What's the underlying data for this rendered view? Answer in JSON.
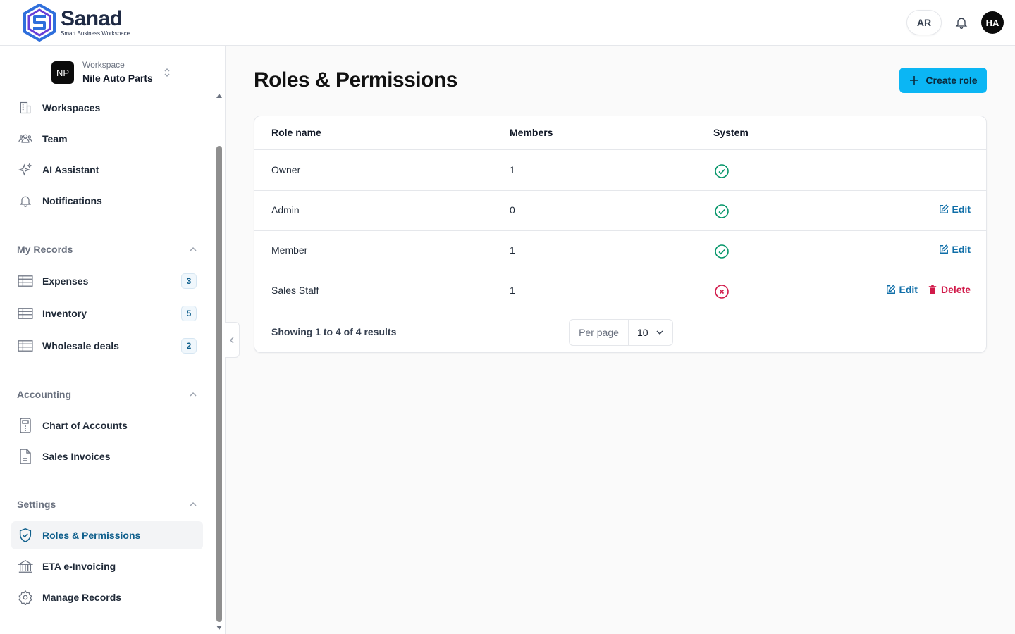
{
  "brand": {
    "name": "Sanad",
    "tagline": "Smart Business Workspace"
  },
  "header": {
    "lang": "AR",
    "user_initials": "HA"
  },
  "workspace": {
    "label": "Workspace",
    "initials": "NP",
    "name": "Nile Auto Parts"
  },
  "sidebar": {
    "top_items": [
      {
        "label": "Workspaces",
        "icon": "building-icon"
      },
      {
        "label": "Team",
        "icon": "users-icon"
      },
      {
        "label": "AI Assistant",
        "icon": "sparkles-icon"
      },
      {
        "label": "Notifications",
        "icon": "bell-icon"
      }
    ],
    "sections": [
      {
        "title": "My Records",
        "items": [
          {
            "label": "Expenses",
            "badge": "3",
            "icon": "table-icon"
          },
          {
            "label": "Inventory",
            "badge": "5",
            "icon": "table-icon"
          },
          {
            "label": "Wholesale deals",
            "badge": "2",
            "icon": "table-icon"
          }
        ]
      },
      {
        "title": "Accounting",
        "items": [
          {
            "label": "Chart of Accounts",
            "icon": "calculator-icon"
          },
          {
            "label": "Sales Invoices",
            "icon": "document-icon"
          }
        ]
      },
      {
        "title": "Settings",
        "items": [
          {
            "label": "Roles & Permissions",
            "icon": "shield-check-icon",
            "active": true
          },
          {
            "label": "ETA e-Invoicing",
            "icon": "bank-icon"
          },
          {
            "label": "Manage Records",
            "icon": "gear-icon"
          }
        ]
      }
    ]
  },
  "main": {
    "title": "Roles & Permissions",
    "create_label": "Create role",
    "table": {
      "headers": {
        "role": "Role name",
        "members": "Members",
        "system": "System"
      },
      "rows": [
        {
          "role": "Owner",
          "members": "1",
          "system": true,
          "edit": false,
          "delete": false
        },
        {
          "role": "Admin",
          "members": "0",
          "system": true,
          "edit": true,
          "delete": false
        },
        {
          "role": "Member",
          "members": "1",
          "system": true,
          "edit": true,
          "delete": false
        },
        {
          "role": "Sales Staff",
          "members": "1",
          "system": false,
          "edit": true,
          "delete": true
        }
      ],
      "edit_label": "Edit",
      "delete_label": "Delete"
    },
    "pagination": {
      "showing": "Showing 1 to 4 of 4 results",
      "per_page_label": "Per page",
      "per_page_value": "10"
    }
  },
  "colors": {
    "accent": "#0bb6f4",
    "active_text": "#0f5f8c",
    "success": "#059669",
    "danger": "#d11a4a",
    "edit": "#0f6ea8"
  }
}
